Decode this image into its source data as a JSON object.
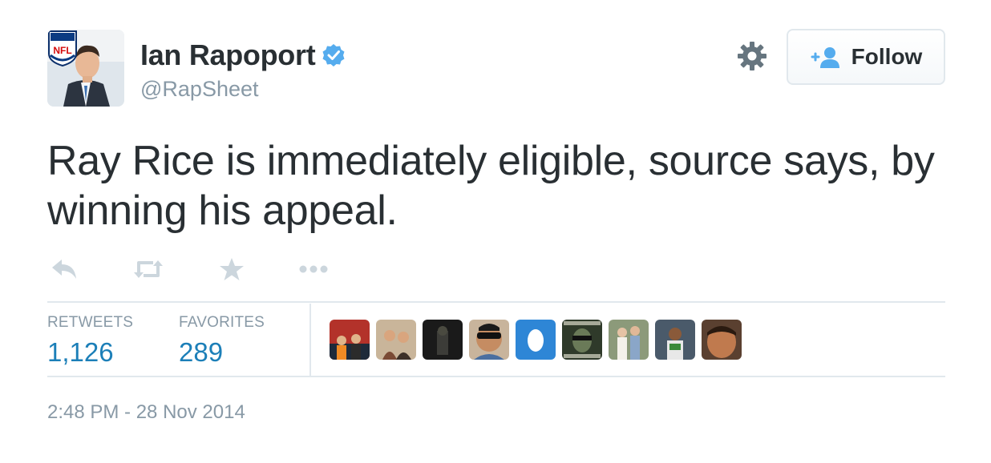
{
  "author": {
    "name": "Ian Rapoport",
    "handle": "@RapSheet",
    "avatar_badge": "NFL"
  },
  "header": {
    "follow_label": "Follow"
  },
  "tweet": {
    "text": "Ray Rice is immediately eligible, source says, by winning his appeal."
  },
  "actions": [
    "reply-icon",
    "retweet-icon",
    "favorite-icon",
    "more-icon"
  ],
  "stats": {
    "retweets_label": "RETWEETS",
    "retweets_value": "1,126",
    "favorites_label": "FAVORITES",
    "favorites_value": "289"
  },
  "timestamp": "2:48 PM - 28 Nov 2014",
  "colors": {
    "verified": "#55acee",
    "stat_value": "#1c7fb8",
    "muted": "#8899a6",
    "icon": "#ccd6dd"
  }
}
